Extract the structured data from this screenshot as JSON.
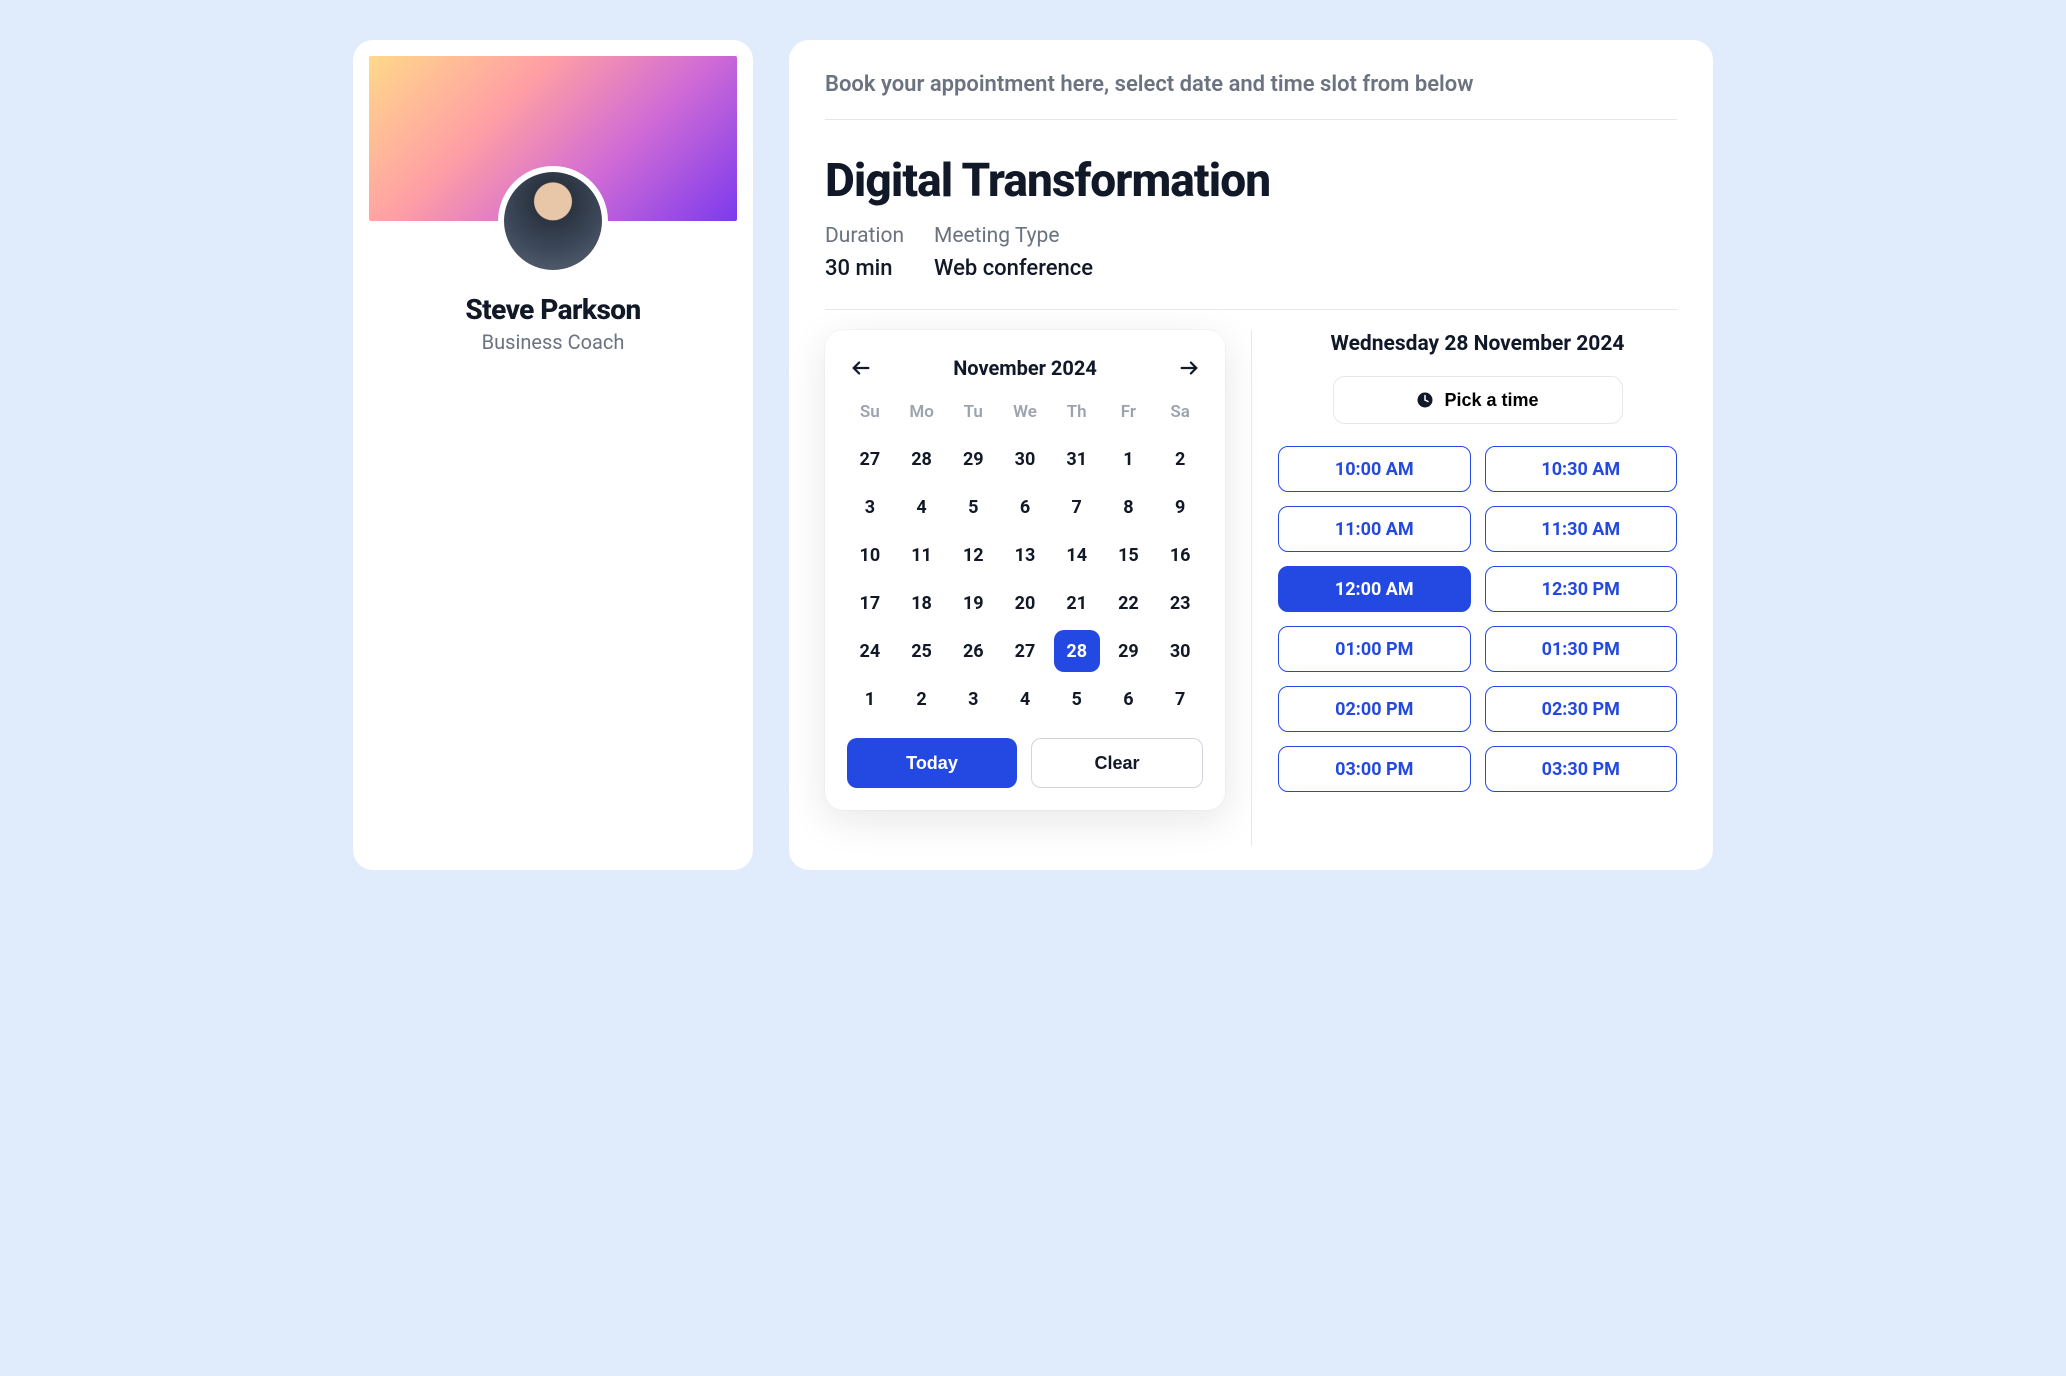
{
  "profile": {
    "name": "Steve Parkson",
    "role": "Business Coach"
  },
  "booking": {
    "instruction": "Book your appointment here, select date and time slot from below",
    "title": "Digital Transformation",
    "duration_label": "Duration",
    "duration_value": "30 min",
    "meeting_type_label": "Meeting Type",
    "meeting_type_value": "Web conference"
  },
  "calendar": {
    "month_label": "November 2024",
    "today_label": "Today",
    "clear_label": "Clear",
    "dow": [
      "Su",
      "Mo",
      "Tu",
      "We",
      "Th",
      "Fr",
      "Sa"
    ],
    "days": [
      [
        "27",
        "28",
        "29",
        "30",
        "31",
        "1",
        "2"
      ],
      [
        "3",
        "4",
        "5",
        "6",
        "7",
        "8",
        "9"
      ],
      [
        "10",
        "11",
        "12",
        "13",
        "14",
        "15",
        "16"
      ],
      [
        "17",
        "18",
        "19",
        "20",
        "21",
        "22",
        "23"
      ],
      [
        "24",
        "25",
        "26",
        "27",
        "28",
        "29",
        "30"
      ],
      [
        "1",
        "2",
        "3",
        "4",
        "5",
        "6",
        "7"
      ]
    ],
    "selected": {
      "row": 4,
      "col": 4
    }
  },
  "times": {
    "selected_date_label": "Wednesday 28 November 2024",
    "pick_a_time_label": "Pick a time",
    "slots": [
      {
        "label": "10:00 AM",
        "selected": false
      },
      {
        "label": "10:30 AM",
        "selected": false
      },
      {
        "label": "11:00 AM",
        "selected": false
      },
      {
        "label": "11:30 AM",
        "selected": false
      },
      {
        "label": "12:00 AM",
        "selected": true
      },
      {
        "label": "12:30 PM",
        "selected": false
      },
      {
        "label": "01:00 PM",
        "selected": false
      },
      {
        "label": "01:30 PM",
        "selected": false
      },
      {
        "label": "02:00 PM",
        "selected": false
      },
      {
        "label": "02:30 PM",
        "selected": false
      },
      {
        "label": "03:00 PM",
        "selected": false
      },
      {
        "label": "03:30 PM",
        "selected": false
      }
    ]
  }
}
